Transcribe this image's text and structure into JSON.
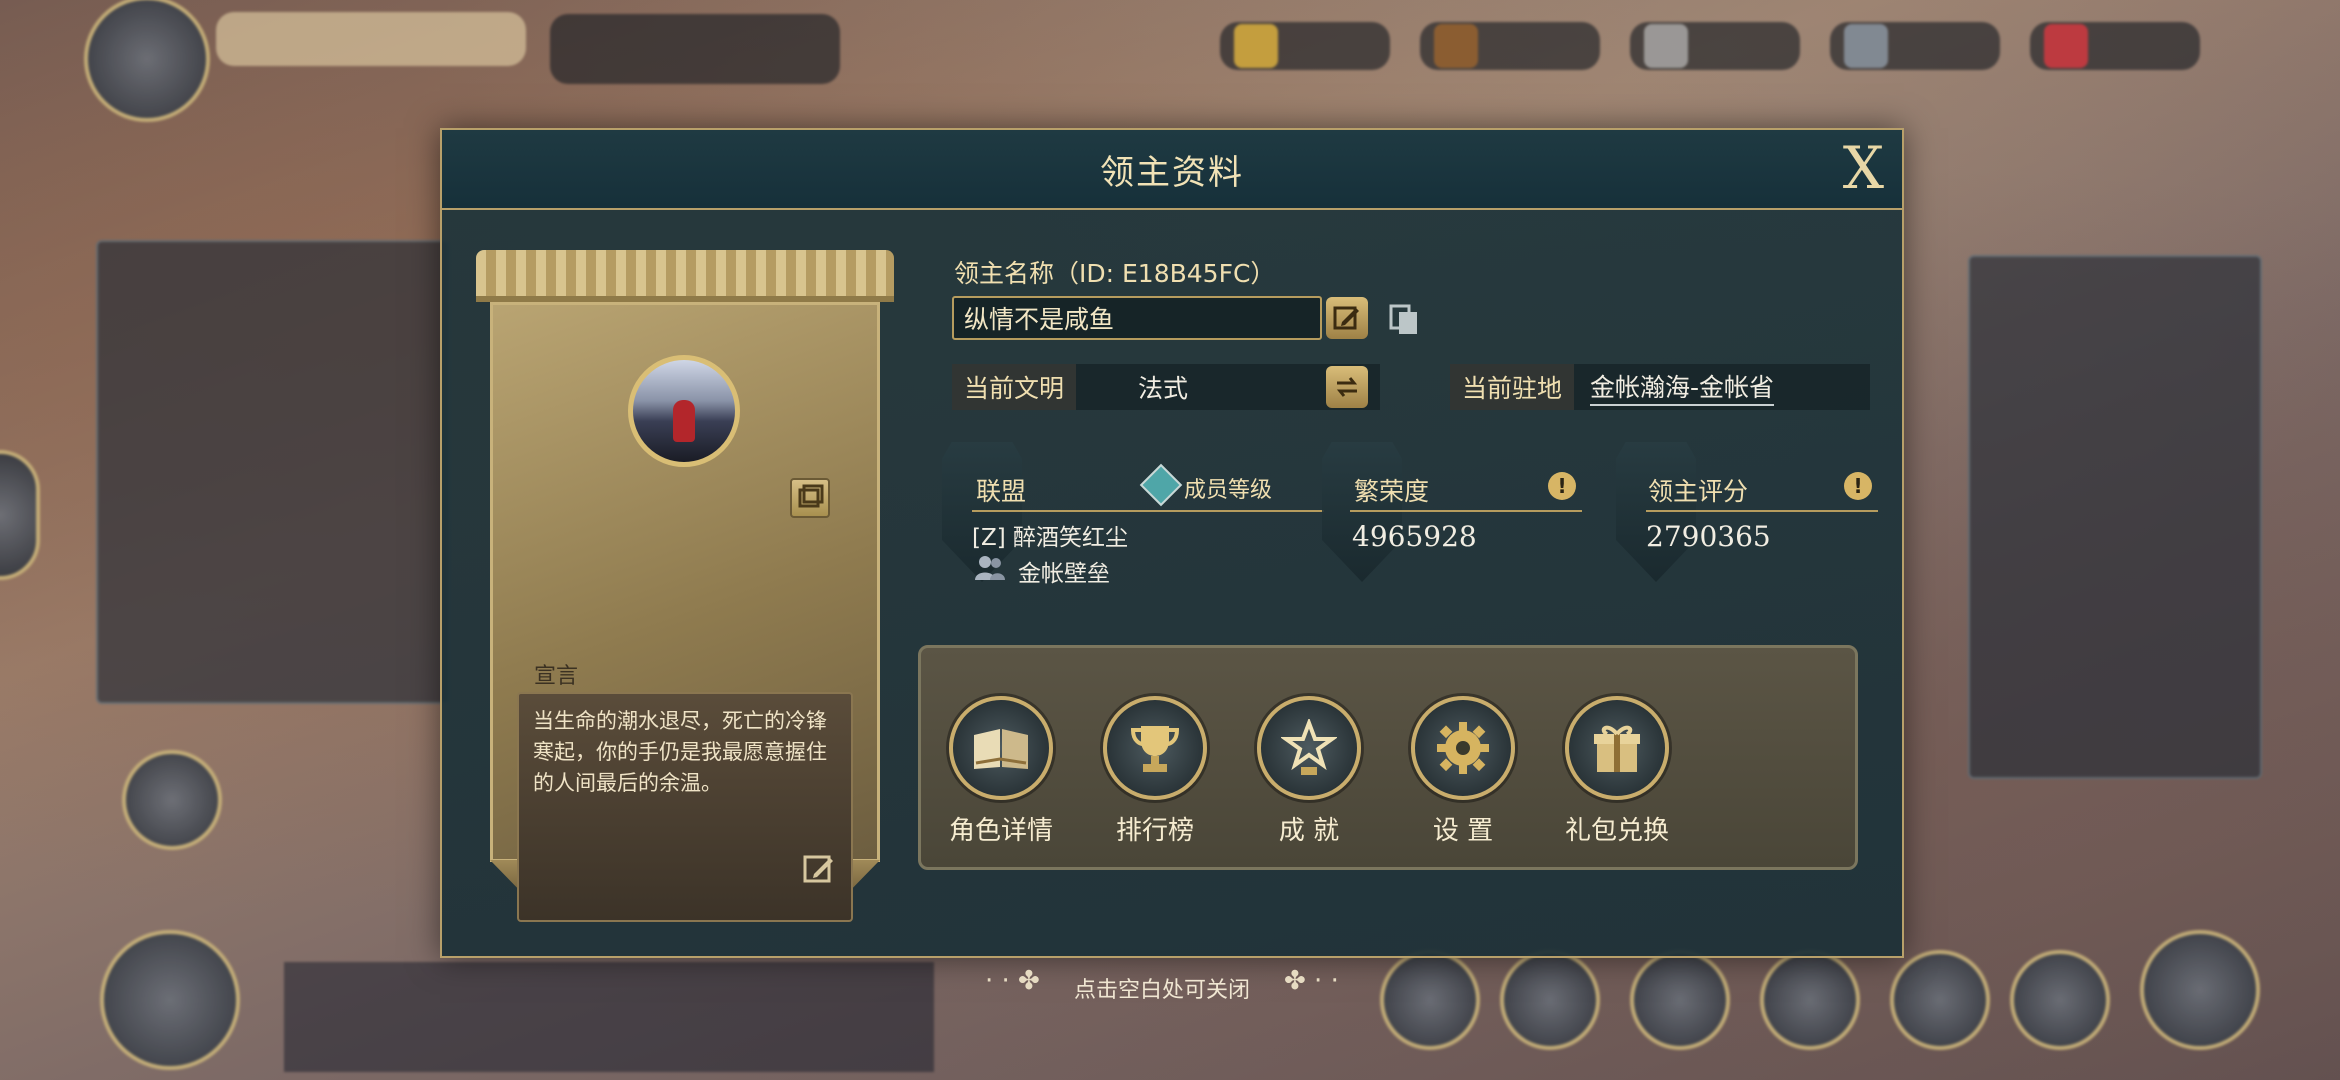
{
  "modal": {
    "title": "领主资料",
    "close_label": "X",
    "name_label": "领主名称（ID: E18B45FC）",
    "name_value": "纵情不是咸鱼",
    "civilization_label": "当前文明",
    "civilization_value": "法式",
    "station_label": "当前驻地",
    "station_value": "金帐瀚海-金帐省",
    "declaration_label": "宣言",
    "declaration_text": "当生命的潮水退尽，死亡的冷锋寒起，你的手仍是我最愿意握住的人间最后的余温。",
    "alliance": {
      "title": "联盟",
      "member_rank_label": "成员等级",
      "alliance_name": "[Z] 醉酒笑红尘",
      "alliance_group": "金帐壁垒"
    },
    "prosperity": {
      "title": "繁荣度",
      "value": "4965928"
    },
    "lord_score": {
      "title": "领主评分",
      "value": "2790365"
    },
    "actions": [
      {
        "label": "角色详情",
        "icon": "book-icon"
      },
      {
        "label": "排行榜",
        "icon": "trophy-icon"
      },
      {
        "label": "成 就",
        "icon": "star-icon"
      },
      {
        "label": "设 置",
        "icon": "gear-icon"
      },
      {
        "label": "礼包兑换",
        "icon": "gift-icon"
      }
    ]
  },
  "hint": "点击空白处可关闭",
  "colors": {
    "gold": "#b8a06a",
    "panel": "#1e343a",
    "accent_text": "#f0dfb0"
  }
}
